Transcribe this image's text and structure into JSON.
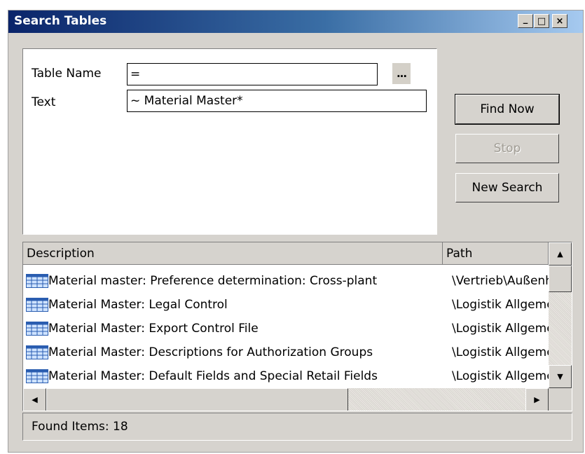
{
  "window": {
    "title": "Search Tables",
    "minimize": "_",
    "maximize": "□",
    "close": "×"
  },
  "form": {
    "table_name_label": "Table Name",
    "table_name_value": "=",
    "browse_label": "...",
    "text_label": "Text",
    "text_value": "~ Material Master*"
  },
  "buttons": {
    "find_now_label": "Find Now",
    "stop_label": "Stop",
    "new_search_label": "New Search"
  },
  "results": {
    "columns": [
      "Description",
      "Path"
    ],
    "rows": [
      {
        "description": "Material master: Preference determination: Cross-plant",
        "path": "\\Vertrieb\\Außenh"
      },
      {
        "description": "Material Master: Legal Control",
        "path": "\\Logistik Allgemein"
      },
      {
        "description": "Material Master: Export Control File",
        "path": "\\Logistik Allgemein"
      },
      {
        "description": "Material Master: Descriptions for Authorization Groups",
        "path": "\\Logistik Allgemein"
      },
      {
        "description": "Material Master: Default Fields and Special Retail Fields",
        "path": "\\Logistik Allgemein"
      }
    ],
    "row_icon": "table-icon"
  },
  "status": {
    "text": "Found Items: 18"
  }
}
